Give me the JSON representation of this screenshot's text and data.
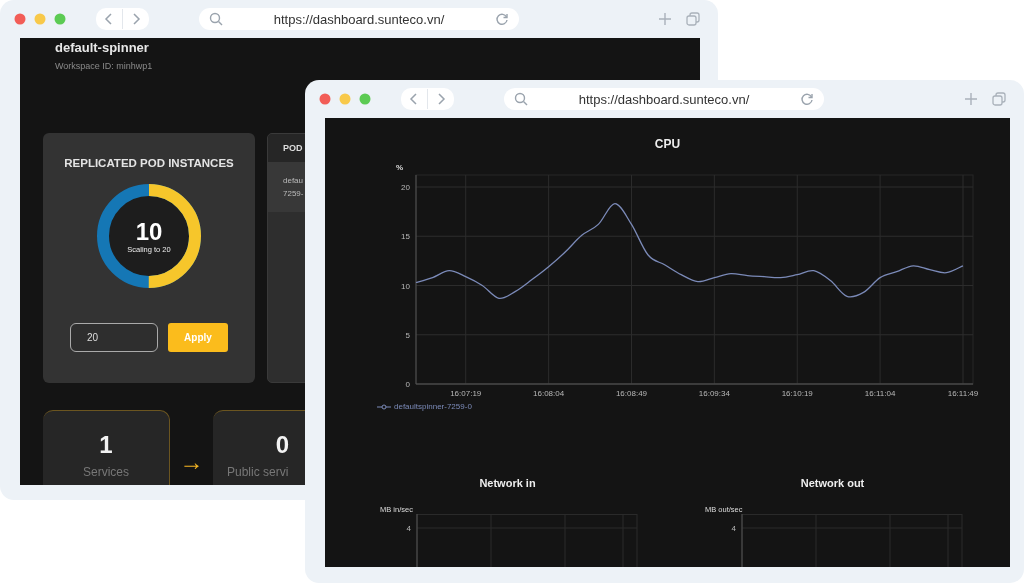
{
  "back_window": {
    "url": "https://dashboard.sunteco.vn/",
    "workspace": {
      "name": "default-spinner",
      "id_label": "Workspace ID: minhwp1"
    },
    "replicas": {
      "title": "REPLICATED POD INSTANCES",
      "current": "10",
      "caption": "Scaling to 20",
      "level": 0.5,
      "input_value": "20",
      "apply_button": "Apply"
    },
    "pod_table": {
      "header": "POD",
      "cell_lines": [
        "defau",
        "7259-"
      ]
    },
    "tiles": [
      {
        "count": "1",
        "label": "Services"
      },
      {
        "count": "0",
        "label": "Public servi"
      }
    ],
    "arrow": "→"
  },
  "front_window": {
    "url": "https://dashboard.sunteco.vn/",
    "cpu": {
      "chart_data": {
        "type": "line",
        "grid": true,
        "title": "CPU",
        "ylabel": "%",
        "ylim": [
          0,
          20
        ],
        "yticks": [
          0,
          5,
          10,
          15,
          20
        ],
        "categories": [
          null,
          null,
          null,
          "16:07:19",
          null,
          null,
          null,
          null,
          "16:08:04",
          null,
          null,
          null,
          null,
          "16:08:49",
          null,
          null,
          null,
          null,
          "16:09:34",
          null,
          null,
          null,
          null,
          "16:10:19",
          null,
          null,
          null,
          null,
          "16:11:04",
          null,
          null,
          null,
          null,
          "16:11:49"
        ],
        "series": [
          {
            "name": "defaultspinner-7259-0",
            "color": "#7b8ab8",
            "values": [
              10.3,
              10.8,
              11.5,
              10.9,
              10.0,
              8.7,
              9.4,
              10.6,
              11.9,
              13.4,
              15.1,
              16.2,
              18.3,
              16.2,
              13.1,
              12.1,
              11.1,
              10.4,
              10.8,
              11.2,
              11.0,
              10.9,
              10.8,
              11.1,
              11.5,
              10.5,
              8.9,
              9.3,
              10.8,
              11.4,
              12.0,
              11.6,
              11.3,
              12.0
            ]
          }
        ]
      }
    },
    "network": [
      {
        "title": "Network in",
        "ylabel": "MB in/sec",
        "ytick": "4"
      },
      {
        "title": "Network out",
        "ylabel": "MB out/sec",
        "ytick": "4"
      }
    ]
  }
}
